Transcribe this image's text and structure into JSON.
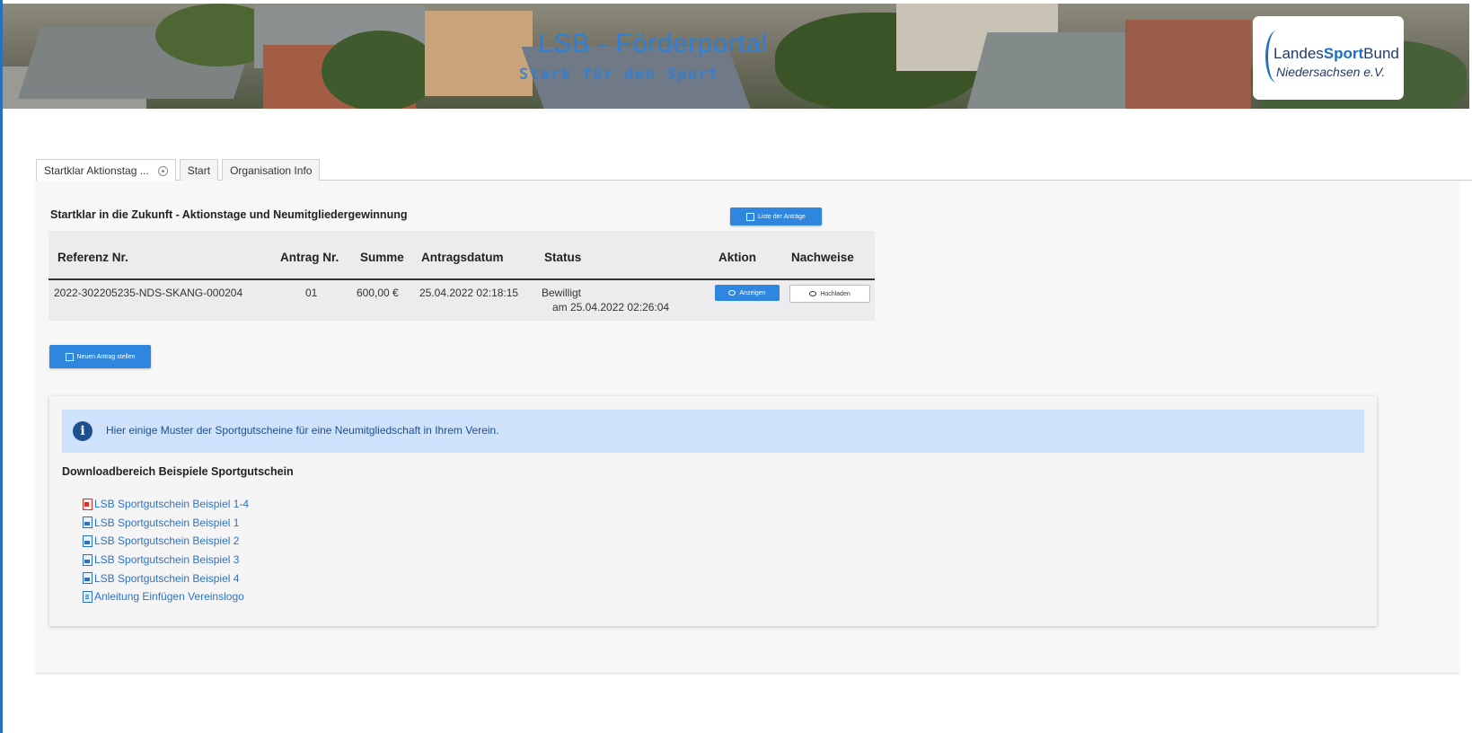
{
  "header": {
    "title": "LSB - Förderportal",
    "subtitle": "Stark für den Sport",
    "logo": {
      "line1_a": "Landes",
      "line1_b": "Sport",
      "line1_c": "Bund",
      "line2": "Niedersachsen e.V."
    }
  },
  "tabs": [
    {
      "label": "Startklar Aktionstag ..."
    },
    {
      "label": "Start"
    },
    {
      "label": "Organisation Info"
    }
  ],
  "main": {
    "section_title": "Startklar in die Zukunft - Aktionstage und Neumitgliedergewinnung",
    "list_button": "Liste der Anträge",
    "new_button": "Neuen Antrag stellen"
  },
  "table": {
    "columns": [
      "Referenz Nr.",
      "Antrag Nr.",
      "Summe",
      "Antragsdatum",
      "Status",
      "Aktion",
      "Nachweise"
    ],
    "rows": [
      {
        "referenz": "2022-302205235-NDS-SKANG-000204",
        "antrag": "01",
        "summe": "600,00 €",
        "datum": "25.04.2022 02:18:15",
        "status_line1": "Bewilligt",
        "status_line2": "am 25.04.2022 02:26:04",
        "action_label": "Anzeigen",
        "upload_label": "Hochladen"
      }
    ]
  },
  "info": {
    "alert_text": "Hier einige Muster der Sportgutscheine für eine Neumitgliedschaft in Ihrem Verein.",
    "download_title": "Downloadbereich Beispiele Sportgutschein",
    "downloads": [
      {
        "label": "LSB Sportgutschein Beispiel 1-4",
        "icon": "pdf-file-icon"
      },
      {
        "label": "LSB Sportgutschein Beispiel 1",
        "icon": "image-file-icon"
      },
      {
        "label": "LSB Sportgutschein Beispiel 2",
        "icon": "image-file-icon"
      },
      {
        "label": "LSB Sportgutschein Beispiel 3",
        "icon": "image-file-icon"
      },
      {
        "label": "LSB Sportgutschein Beispiel 4",
        "icon": "image-file-icon"
      },
      {
        "label": "Anleitung Einfügen Vereinslogo",
        "icon": "document-file-icon"
      }
    ]
  },
  "colors": {
    "accent": "#2e86de",
    "link": "#2e72c4",
    "alert_bg": "#cfe2fb",
    "title_blue": "#2e7fd6"
  }
}
